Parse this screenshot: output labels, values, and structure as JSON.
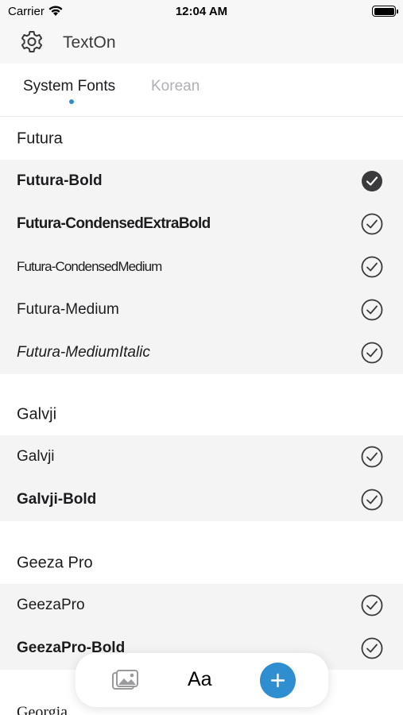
{
  "status_bar": {
    "carrier": "Carrier",
    "time": "12:04 AM"
  },
  "nav": {
    "title": "TextOn"
  },
  "tabs": [
    {
      "label": "System Fonts",
      "active": true
    },
    {
      "label": "Korean",
      "active": false
    }
  ],
  "sections": [
    {
      "header": "Futura",
      "rows": [
        {
          "label": "Futura-Bold",
          "selected": true
        },
        {
          "label": "Futura-CondensedExtraBold",
          "selected": false
        },
        {
          "label": "Futura-CondensedMedium",
          "selected": false
        },
        {
          "label": "Futura-Medium",
          "selected": false
        },
        {
          "label": "Futura-MediumItalic",
          "selected": false
        }
      ]
    },
    {
      "header": "Galvji",
      "rows": [
        {
          "label": "Galvji",
          "selected": false
        },
        {
          "label": "Galvji-Bold",
          "selected": false
        }
      ]
    },
    {
      "header": "Geeza Pro",
      "rows": [
        {
          "label": "GeezaPro",
          "selected": false
        },
        {
          "label": "GeezaPro-Bold",
          "selected": false
        }
      ]
    },
    {
      "header": "Georgia",
      "rows": []
    }
  ],
  "toolbar": {
    "font_label": "Aa"
  },
  "colors": {
    "accent": "#2f8ed0",
    "row_bg": "#f4f4f4",
    "nav_bg": "#f7f7f7"
  }
}
